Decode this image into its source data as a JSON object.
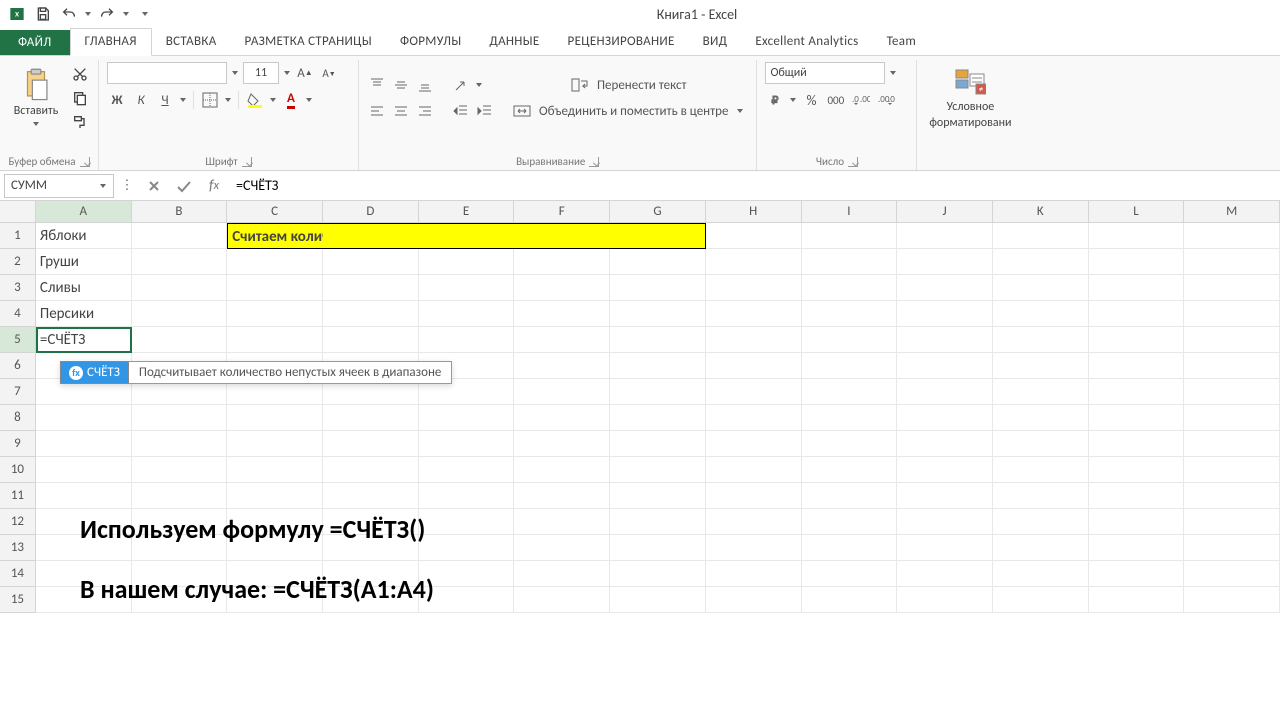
{
  "window": {
    "title": "Книга1 - Excel"
  },
  "qat_icons": [
    "excel-icon",
    "save-icon",
    "undo-icon",
    "redo-icon",
    "customize-icon"
  ],
  "tabs": {
    "file": "ФАЙЛ",
    "items": [
      "ГЛАВНАЯ",
      "ВСТАВКА",
      "РАЗМЕТКА СТРАНИЦЫ",
      "ФОРМУЛЫ",
      "ДАННЫЕ",
      "РЕЦЕНЗИРОВАНИЕ",
      "ВИД",
      "Excellent Analytics",
      "Team"
    ],
    "active": 0
  },
  "ribbon": {
    "clipboard": {
      "paste": "Вставить",
      "label": "Буфер обмена"
    },
    "font": {
      "name_placeholder": "",
      "size": "11",
      "bold": "Ж",
      "italic": "К",
      "underline": "Ч",
      "label": "Шрифт"
    },
    "alignment": {
      "wrap": "Перенести текст",
      "merge": "Объединить и поместить в центре",
      "label": "Выравнивание"
    },
    "number": {
      "format": "Общий",
      "label": "Число"
    },
    "styles": {
      "conditional": "Условное",
      "conditional2": "форматировани",
      "label": ""
    }
  },
  "formula_bar": {
    "name_box": "СУММ",
    "formula": "=СЧЁТЗ"
  },
  "columns": [
    "A",
    "B",
    "C",
    "D",
    "E",
    "F",
    "G",
    "H",
    "I",
    "J",
    "K",
    "L",
    "M"
  ],
  "row_count": 15,
  "cells": {
    "A1": "Яблоки",
    "A2": "Груши",
    "A3": "Сливы",
    "A4": "Персики",
    "A5": "=СЧЁТЗ",
    "C1_banner": "Считаем количество значений в ячейках"
  },
  "tooltip": {
    "fn": "СЧЁТЗ",
    "desc": "Подсчитывает количество непустых ячеек в диапазоне"
  },
  "overlay": {
    "line1": "Используем формулу =СЧЁТЗ()",
    "line2": "В нашем случае: =СЧЁТЗ(A1:A4)"
  },
  "active_cell": {
    "row": 5,
    "col": "A"
  }
}
